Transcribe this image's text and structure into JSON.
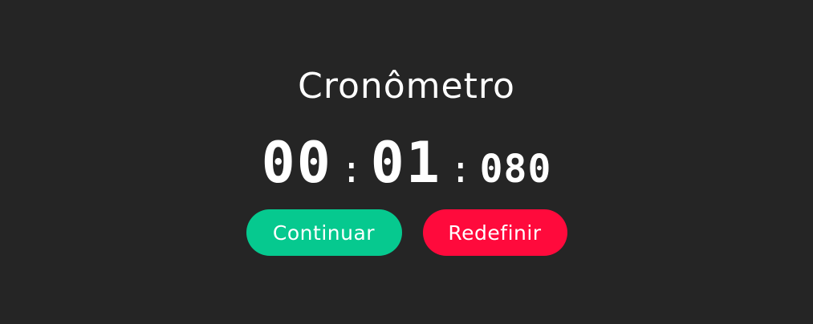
{
  "app": {
    "title": "Cronômetro"
  },
  "timer": {
    "minutes": "00",
    "seconds": "01",
    "milliseconds": "080",
    "separator": ":"
  },
  "controls": {
    "continue_label": "Continuar",
    "reset_label": "Redefinir"
  },
  "colors": {
    "background": "#252525",
    "text": "#ffffff",
    "continue_button": "#06c98f",
    "reset_button": "#ff0a3c"
  }
}
